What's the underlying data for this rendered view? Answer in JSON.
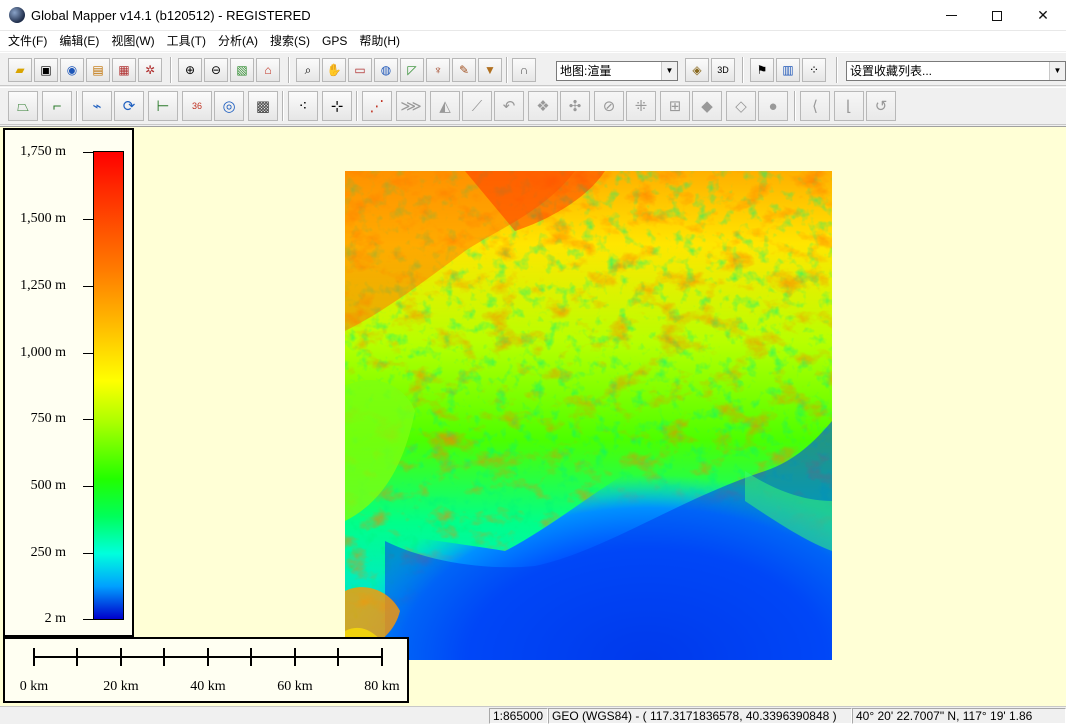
{
  "window": {
    "title": "Global Mapper v14.1 (b120512) - REGISTERED"
  },
  "menu": [
    "文件(F)",
    "编辑(E)",
    "视图(W)",
    "工具(T)",
    "分析(A)",
    "搜索(S)",
    "GPS",
    "帮助(H)"
  ],
  "toolbar": {
    "layer_combo": "地图:渲量",
    "favorites_combo": "设置收藏列表..."
  },
  "legend": {
    "labels": [
      "1,750 m",
      "1,500 m",
      "1,250 m",
      "1,000 m",
      "750 m",
      "500 m",
      "250 m",
      "2 m"
    ],
    "colors": [
      "#ff0000",
      "#ff7a00",
      "#ffff00",
      "#22ff00",
      "#00ffdd",
      "#00a0ff",
      "#0000cc"
    ]
  },
  "scale_bar": {
    "labels": [
      "0 km",
      "20 km",
      "40 km",
      "60 km",
      "80 km"
    ]
  },
  "status": {
    "scale": "1:865000",
    "projection": "GEO (WGS84) - ( 117.3171836578, 40.3396390848 )",
    "dms": "40° 20' 22.7007\" N, 117° 19' 1.86"
  }
}
